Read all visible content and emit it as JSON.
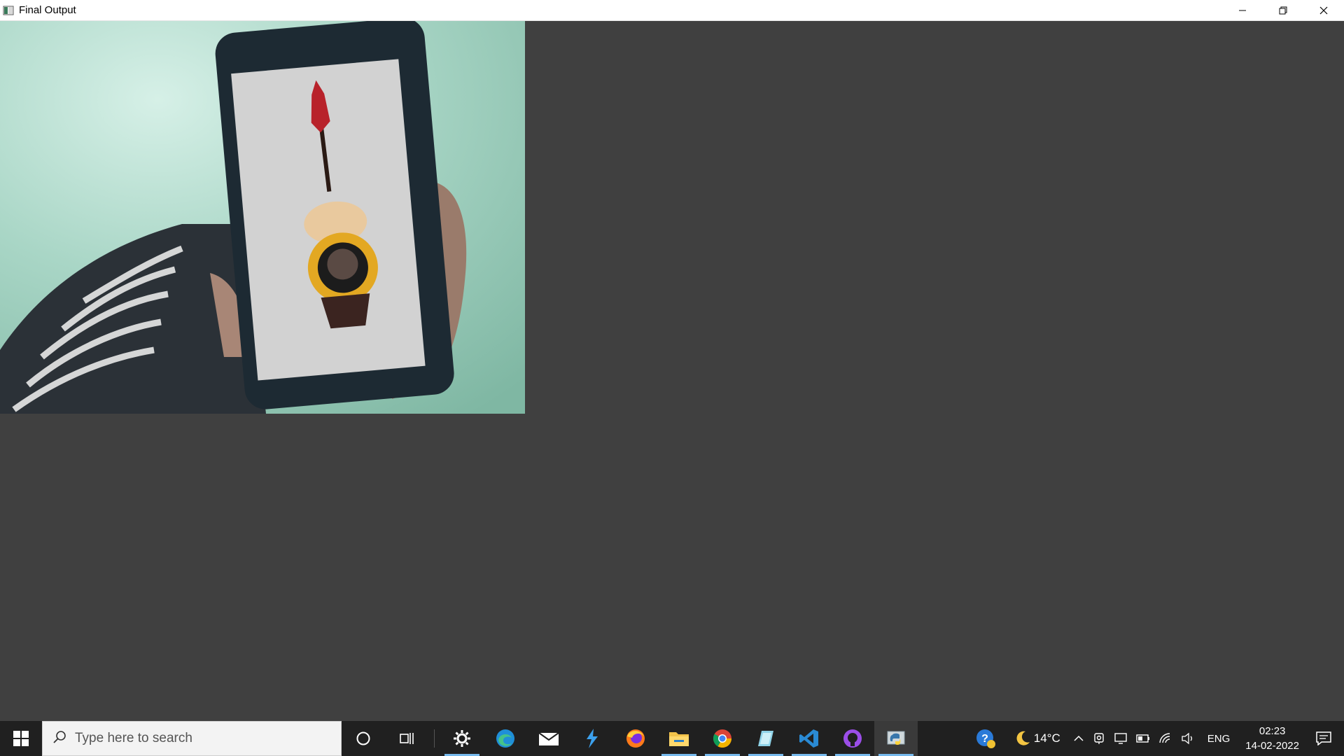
{
  "window": {
    "title": "Final Output",
    "controls": [
      "minimize",
      "restore",
      "close"
    ]
  },
  "camera": {
    "description_icon": "camera-frame"
  },
  "taskbar": {
    "search_placeholder": "Type here to search",
    "apps": [
      {
        "name": "cortana",
        "icon": "circle-icon"
      },
      {
        "name": "task-view",
        "icon": "task-view-icon"
      },
      {
        "name": "settings",
        "icon": "gear-icon"
      },
      {
        "name": "edge",
        "icon": "edge-icon"
      },
      {
        "name": "mail",
        "icon": "mail-icon"
      },
      {
        "name": "visual-studio-installer",
        "icon": "vs-icon"
      },
      {
        "name": "firefox",
        "icon": "firefox-icon"
      },
      {
        "name": "file-explorer",
        "icon": "folder-icon"
      },
      {
        "name": "chrome",
        "icon": "chrome-icon"
      },
      {
        "name": "notepad",
        "icon": "notepad-icon"
      },
      {
        "name": "vscode",
        "icon": "vscode-icon"
      },
      {
        "name": "github-desktop",
        "icon": "github-icon"
      },
      {
        "name": "python",
        "icon": "python-icon"
      }
    ],
    "weather": {
      "temp": "14°C"
    },
    "language": "ENG",
    "time": "02:23",
    "date": "14-02-2022"
  },
  "colors": {
    "taskbar_bg": "#202020",
    "window_bg": "#404040",
    "accent": "#76b9ed"
  }
}
